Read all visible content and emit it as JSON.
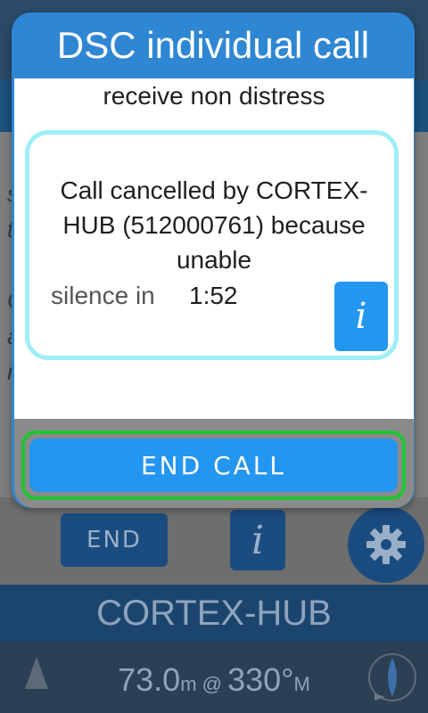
{
  "background": {
    "bg_text_lines": [
      "s",
      "t",
      "C",
      "a",
      "r"
    ],
    "end_button_label": "END",
    "info_label": "i",
    "station_name": "CORTEX-HUB",
    "nav": {
      "distance": "73.0",
      "distance_unit": "m",
      "at": " @ ",
      "bearing": "330°",
      "bearing_unit": "M"
    }
  },
  "dialog": {
    "title": "DSC individual call",
    "subtitle": "receive non distress",
    "message": "Call cancelled by CORTEX-HUB (512000761) because unable",
    "silence_label": "silence in",
    "silence_time": "1:52",
    "info_label": "i",
    "end_call_label": "END CALL"
  },
  "colors": {
    "dialog_blue": "#2f86d3",
    "button_blue": "#2396f0",
    "message_border": "#9feef6",
    "focus_outline": "#1fc432"
  }
}
